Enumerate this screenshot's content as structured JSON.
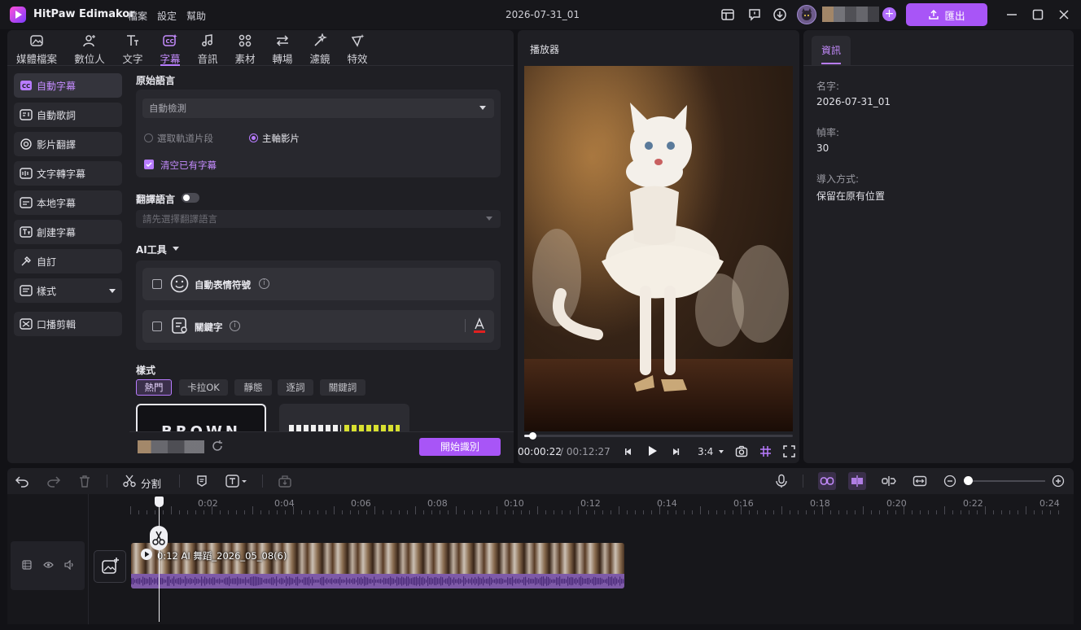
{
  "app": {
    "name": "HitPaw Edimakor",
    "menus": [
      "檔案",
      "設定",
      "幫助"
    ],
    "project_title": "2026-07-31_01",
    "export_label": "匯出"
  },
  "tabs": [
    {
      "label": "媒體檔案",
      "icon": "media-icon"
    },
    {
      "label": "數位人",
      "icon": "avatar-person-icon"
    },
    {
      "label": "文字",
      "icon": "text-icon"
    },
    {
      "label": "字幕",
      "icon": "subtitle-icon",
      "active": true
    },
    {
      "label": "音訊",
      "icon": "music-icon"
    },
    {
      "label": "素材",
      "icon": "elements-icon"
    },
    {
      "label": "轉場",
      "icon": "transition-icon"
    },
    {
      "label": "濾鏡",
      "icon": "filter-icon"
    },
    {
      "label": "特效",
      "icon": "effects-icon"
    }
  ],
  "sidebar": {
    "items": [
      {
        "label": "自動字幕",
        "icon": "cc-icon",
        "active": true
      },
      {
        "label": "自動歌詞",
        "icon": "lyrics-icon"
      },
      {
        "label": "影片翻譯",
        "icon": "translate-icon"
      },
      {
        "label": "文字轉字幕",
        "icon": "text-to-subtitle-icon"
      },
      {
        "label": "本地字幕",
        "icon": "local-subtitle-icon"
      },
      {
        "label": "創建字幕",
        "icon": "create-subtitle-icon"
      },
      {
        "label": "自訂",
        "icon": "custom-icon"
      },
      {
        "label": "樣式",
        "icon": "style-icon"
      },
      {
        "label": "口播剪輯",
        "icon": "speech-cut-icon"
      }
    ]
  },
  "subtitle_panel": {
    "source_language_title": "原始語言",
    "source_language_value": "自動檢測",
    "radio_selected_clip": "選取軌道片段",
    "radio_main_video": "主軸影片",
    "clear_existing": "清空已有字幕",
    "translate_title": "翻譯語言",
    "translate_placeholder": "請先選擇翻譯語言",
    "ai_tools_title": "AI工具",
    "auto_emoji": "自動表情符號",
    "keywords": "關鍵字",
    "style_title": "樣式",
    "style_chips": [
      "熱門",
      "卡拉OK",
      "靜態",
      "逐詞",
      "關鍵詞"
    ],
    "style_preview_1": "BROWN",
    "start_button": "開始識別"
  },
  "player": {
    "title": "播放器",
    "current_time": "00:00:22",
    "total_time": "/ 00:12:27",
    "aspect": "3:4",
    "progress": 0.029
  },
  "info": {
    "tab_label": "資訊",
    "fields": [
      {
        "label": "名字:",
        "value": "2026-07-31_01"
      },
      {
        "label": "幀率:",
        "value": "30"
      },
      {
        "label": "導入方式:",
        "value": "保留在原有位置"
      }
    ]
  },
  "timeline": {
    "split_label": "分割",
    "ruler": [
      "0:02",
      "0:04",
      "0:06",
      "0:08",
      "0:10",
      "0:12",
      "0:14",
      "0:16",
      "0:18",
      "0:20",
      "0:22",
      "0:24"
    ],
    "clip_label": "0:12 AI 舞蹈_2026_05_08(6)"
  },
  "colors": {
    "accent": "#a855f7",
    "panel": "#1f1f24",
    "background": "#121216"
  }
}
